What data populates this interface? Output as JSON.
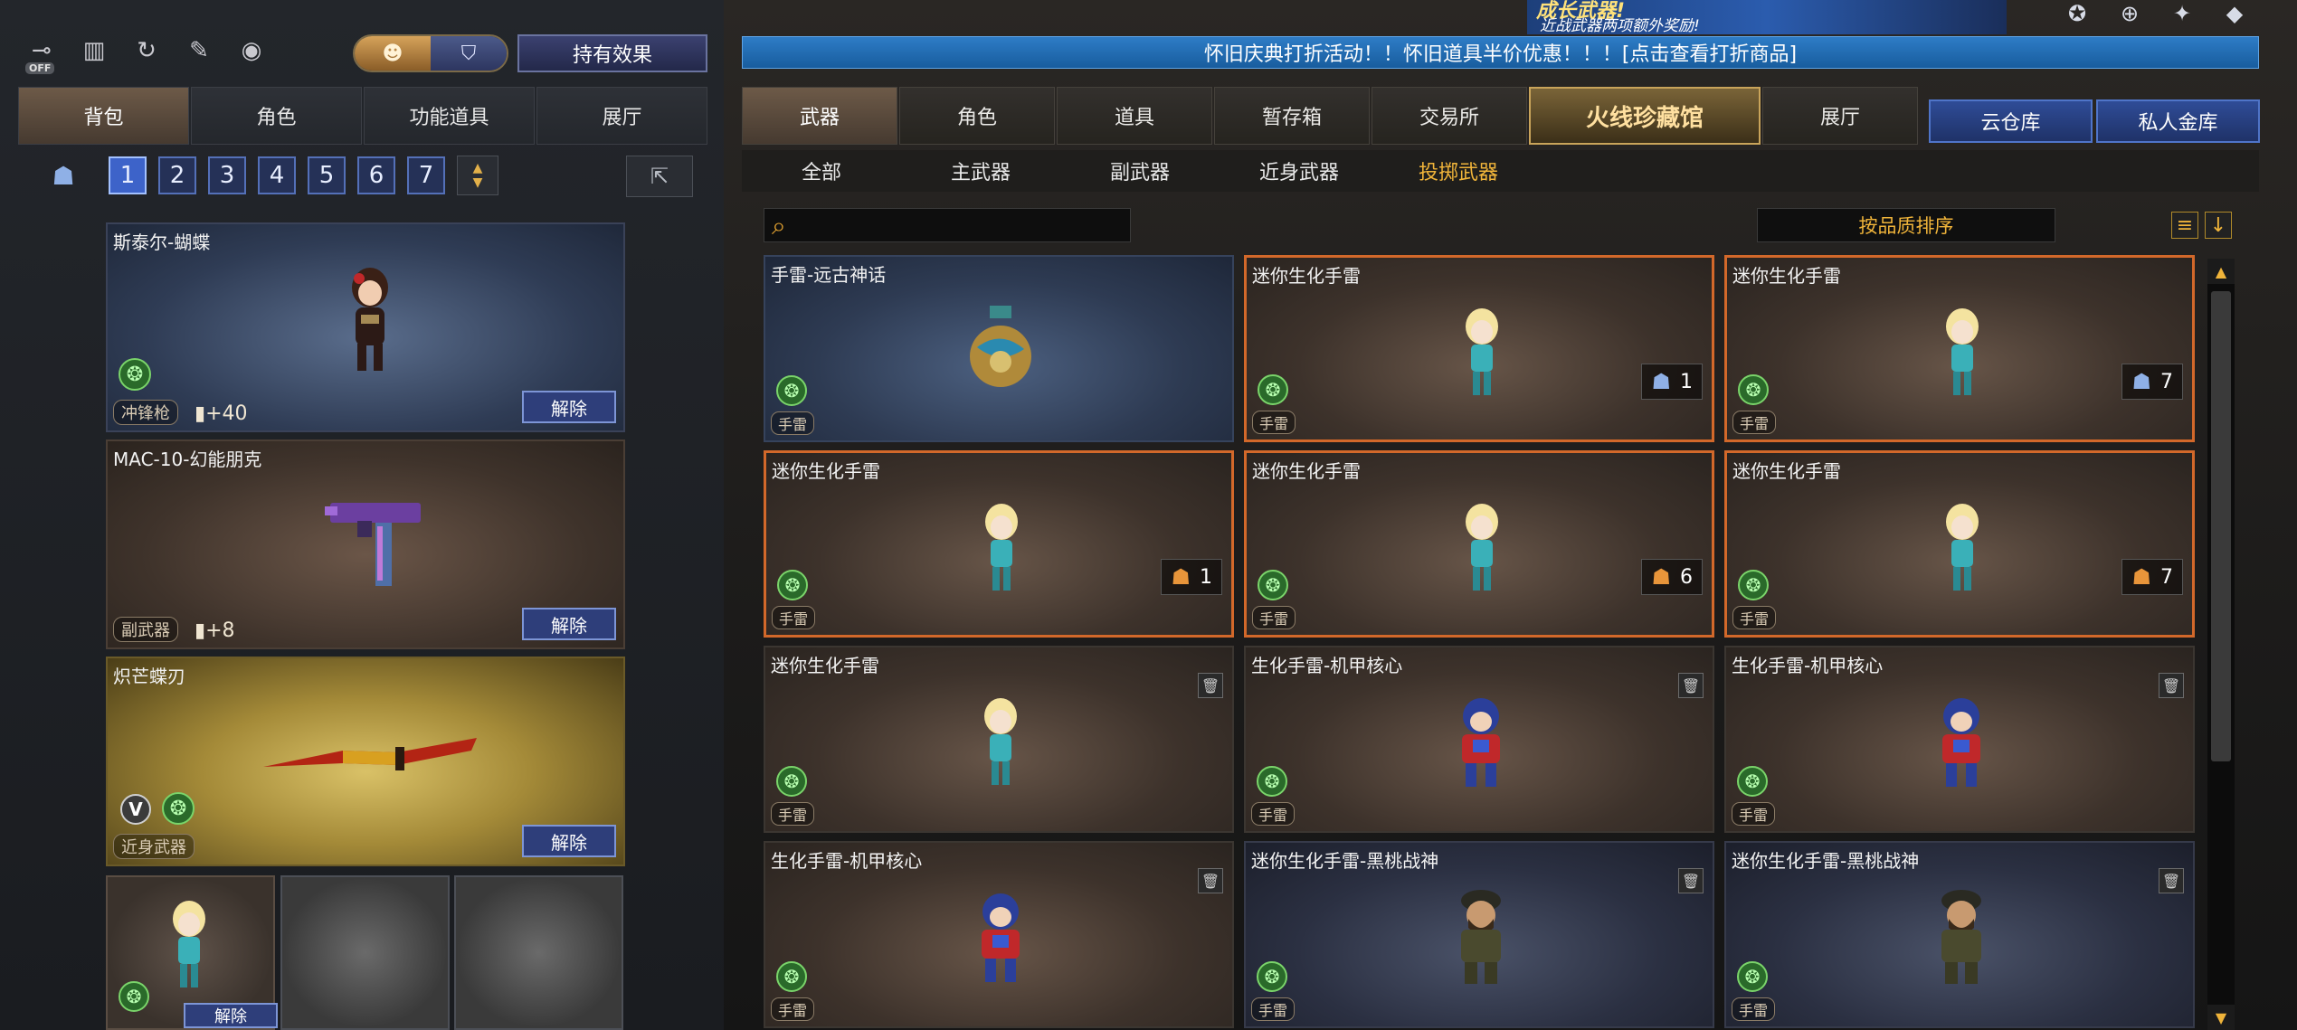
{
  "top_bar": {
    "icons": [
      "toggle-off-icon",
      "podium-icon",
      "replay-icon",
      "character-edit-icon",
      "mouse-icon"
    ],
    "off_label": "OFF",
    "effect_button": "持有效果"
  },
  "left_tabs": [
    "背包",
    "角色",
    "功能道具",
    "展厅"
  ],
  "pages": [
    "1",
    "2",
    "3",
    "4",
    "5",
    "6",
    "7"
  ],
  "equipped": [
    {
      "name": "斯泰尔-蝴蝶",
      "type": "冲锋枪",
      "ammo": "+40",
      "remove": "解除"
    },
    {
      "name": "MAC-10-幻能朋克",
      "type": "副武器",
      "ammo": "+8",
      "remove": "解除"
    },
    {
      "name": "炽芒蝶刃",
      "type": "近身武器",
      "remove": "解除"
    }
  ],
  "mini_slot_remove": "解除",
  "banner": {
    "title": "成长武器!",
    "subtitle": "近战武器两项额外奖励!"
  },
  "notice": "怀旧庆典打折活动！！怀旧道具半价优惠！！！[点击查看打折商品]",
  "right_tabs": [
    "武器",
    "角色",
    "道具",
    "暂存箱",
    "交易所",
    "火线珍藏馆",
    "展厅"
  ],
  "store_tabs": [
    "云仓库",
    "私人金库"
  ],
  "filters": [
    "全部",
    "主武器",
    "副武器",
    "近身武器",
    "投掷武器"
  ],
  "sort_label": "按品质排序",
  "items": [
    {
      "name": "手雷-远古神话",
      "type": "手雷",
      "count": ""
    },
    {
      "name": "迷你生化手雷",
      "type": "手雷",
      "count": "1"
    },
    {
      "name": "迷你生化手雷",
      "type": "手雷",
      "count": "7"
    },
    {
      "name": "迷你生化手雷",
      "type": "手雷",
      "count": "1"
    },
    {
      "name": "迷你生化手雷",
      "type": "手雷",
      "count": "6"
    },
    {
      "name": "迷你生化手雷",
      "type": "手雷",
      "count": "7"
    },
    {
      "name": "迷你生化手雷",
      "type": "手雷",
      "count": ""
    },
    {
      "name": "生化手雷-机甲核心",
      "type": "手雷",
      "count": ""
    },
    {
      "name": "生化手雷-机甲核心",
      "type": "手雷",
      "count": ""
    },
    {
      "name": "生化手雷-机甲核心",
      "type": "手雷",
      "count": ""
    },
    {
      "name": "迷你生化手雷-黑桃战神",
      "type": "手雷",
      "count": ""
    },
    {
      "name": "迷你生化手雷-黑桃战神",
      "type": "手雷",
      "count": ""
    }
  ],
  "colors": {
    "accent_gold": "#f0b43a",
    "page_blue": "#3d63c9",
    "notice_blue": "#2e7cc6",
    "rare_orange": "#d2682a"
  }
}
